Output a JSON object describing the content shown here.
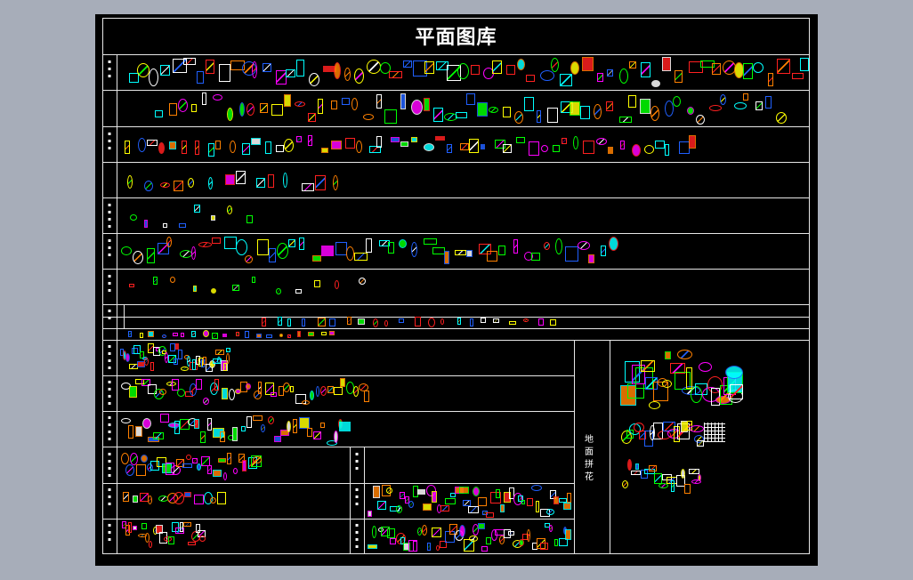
{
  "drawing": {
    "title": "平面图库",
    "floor_pattern_label": "地面拼花"
  },
  "colors": {
    "background": "#a7adb9",
    "sheet": "#000000",
    "frame_line": "#e6e6e6",
    "palette": [
      "#ff00ff",
      "#00ffff",
      "#ffff00",
      "#00ff00",
      "#ff2020",
      "#2060ff",
      "#ffffff",
      "#ff8000"
    ]
  }
}
